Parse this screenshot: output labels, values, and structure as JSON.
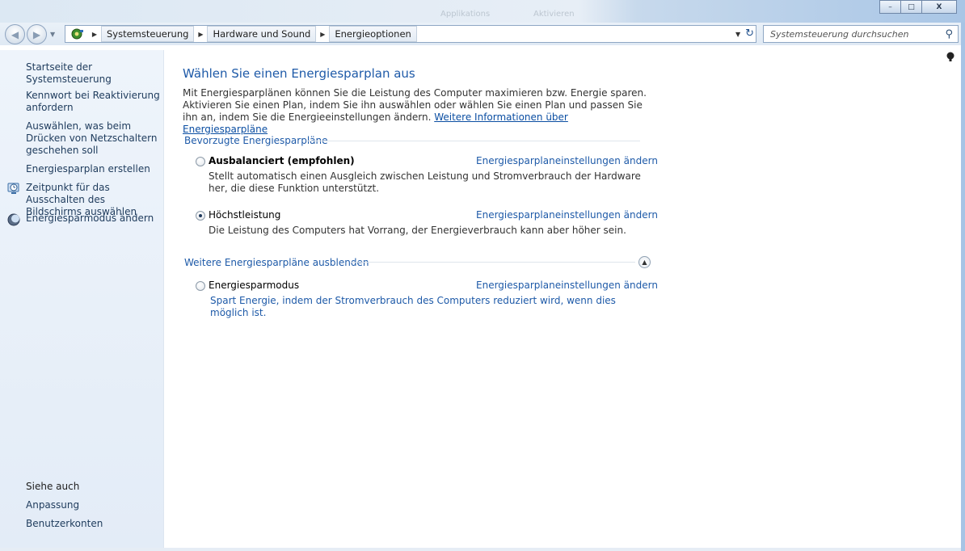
{
  "titlebar": {
    "ghost_left": "Applikations",
    "ghost_right": "Aktivieren",
    "minimize_glyph": "–",
    "maximize_glyph": "□",
    "close_glyph": "X"
  },
  "nav": {
    "back_glyph": "◀",
    "forward_glyph": "▶",
    "dropdown_glyph": "▼",
    "breadcrumb": [
      "Systemsteuerung",
      "Hardware und Sound",
      "Energieoptionen"
    ],
    "crumb_sep": "▶",
    "addr_dropdown": "▼",
    "refresh_glyph": "↻",
    "search_placeholder": "Systemsteuerung durchsuchen",
    "search_glyph": "⚲"
  },
  "sidebar": {
    "home": "Startseite der Systemsteuerung",
    "items": [
      "Kennwort bei Reaktivierung anfordern",
      "Auswählen, was beim Drücken von Netzschaltern geschehen soll",
      "Energiesparplan erstellen",
      "Zeitpunkt für das Ausschalten des Bildschirms auswählen",
      "Energiesparmodus ändern"
    ],
    "see_also_heading": "Siehe auch",
    "see_also": [
      "Anpassung",
      "Benutzerkonten"
    ]
  },
  "main": {
    "title": "Wählen Sie einen Energiesparplan aus",
    "intro_text": "Mit Energiesparplänen können Sie die Leistung des Computer maximieren bzw. Energie sparen. Aktivieren Sie einen Plan, indem Sie ihn auswählen oder wählen Sie einen Plan und passen Sie ihn an, indem Sie die Energieeinstellungen ändern.",
    "intro_link": "Weitere Informationen über Energiesparpläne",
    "preferred_heading": "Bevorzugte Energiesparpläne",
    "more_heading": "Weitere Energiesparpläne ausblenden",
    "collapse_glyph": "▲",
    "help_glyph": "?",
    "plans": [
      {
        "name": "Ausbalanciert (empfohlen)",
        "link": "Energiesparplaneinstellungen ändern",
        "description": "Stellt automatisch einen Ausgleich zwischen Leistung und Stromverbrauch der Hardware her, die diese Funktion unterstützt.",
        "selected": false
      },
      {
        "name": "Höchstleistung",
        "link": "Energiesparplaneinstellungen ändern",
        "description": "Die Leistung des Computers hat Vorrang, der Energieverbrauch kann aber höher sein.",
        "selected": true
      },
      {
        "name": "Energiesparmodus",
        "link": "Energiesparplaneinstellungen ändern",
        "description": "Spart Energie, indem der Stromverbrauch des Computers reduziert wird, wenn dies möglich ist.",
        "selected": false
      }
    ]
  },
  "colors": {
    "link_blue": "#1e5aa8",
    "sidebar_bg": "#e8f0f9",
    "title_blue": "#1e5aa8"
  }
}
